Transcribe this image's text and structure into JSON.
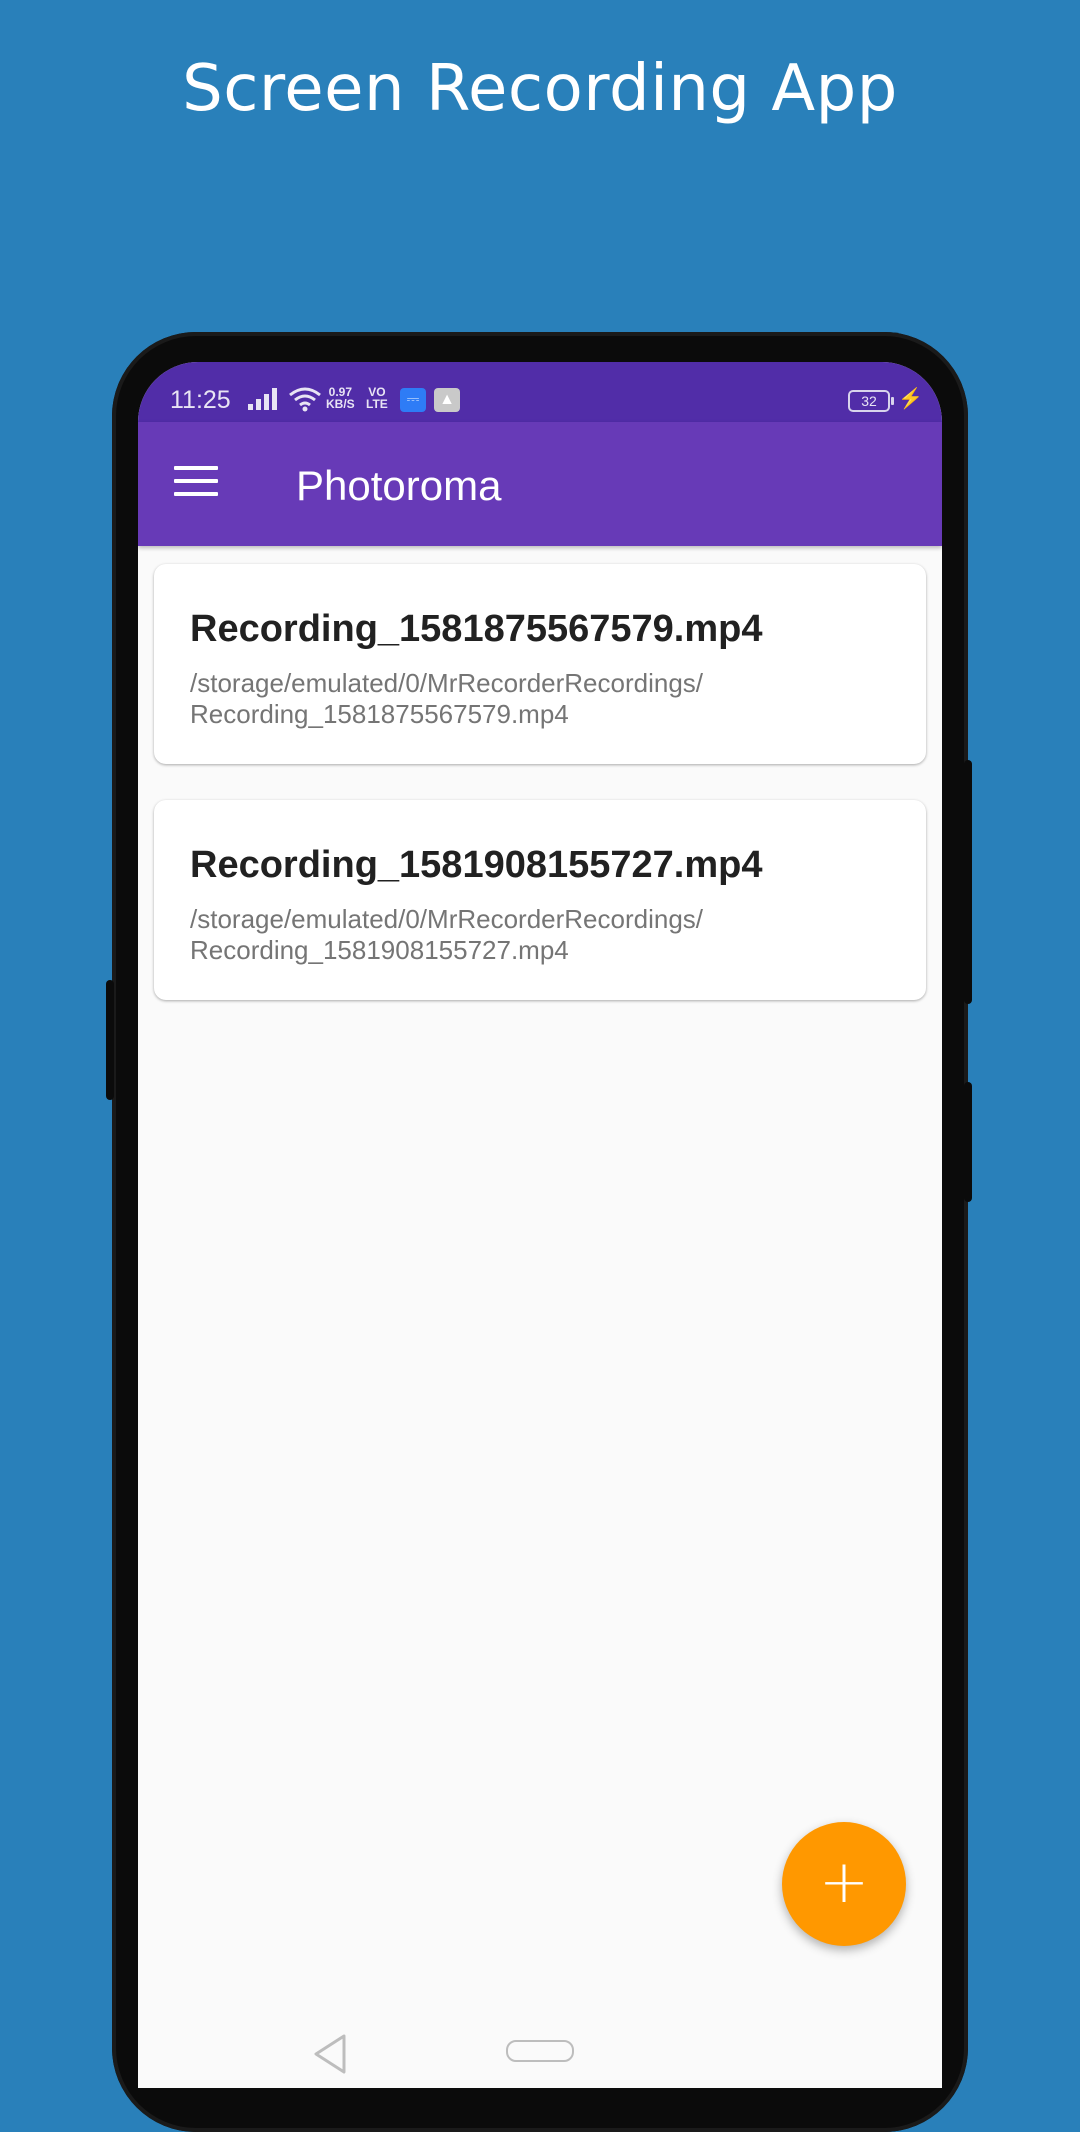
{
  "promo": {
    "title": "Screen Recording App"
  },
  "status_bar": {
    "time": "11:25",
    "net_speed": "0.97",
    "net_unit": "KB/S",
    "volte_top": "VO",
    "volte_bottom": "LTE",
    "battery": "32"
  },
  "app_bar": {
    "title": "Photoroma"
  },
  "recordings": [
    {
      "name": "Recording_1581875567579.mp4",
      "path": "/storage/emulated/0/MrRecorderRecordings/\nRecording_1581875567579.mp4"
    },
    {
      "name": "Recording_1581908155727.mp4",
      "path": "/storage/emulated/0/MrRecorderRecordings/\nRecording_1581908155727.mp4"
    }
  ],
  "fab": {
    "label": "+"
  },
  "colors": {
    "background": "#2980ba",
    "status_bar": "#512da8",
    "app_bar": "#673ab7",
    "fab": "#ff9800"
  },
  "icons": {
    "menu": "menu-icon",
    "signal": "signal-icon",
    "wifi": "wifi-icon",
    "usb": "usb-icon",
    "battery": "battery-icon",
    "charging": "charging-icon",
    "add": "add-icon",
    "back": "back-icon",
    "home": "home-icon"
  }
}
